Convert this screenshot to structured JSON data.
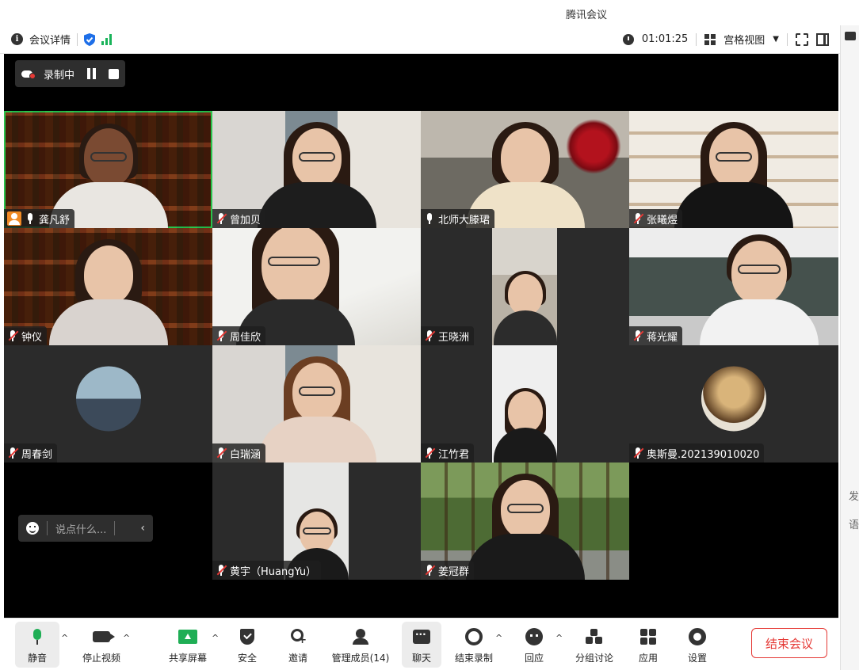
{
  "app": {
    "title": "腾讯会议"
  },
  "topbar": {
    "meeting_details": "会议详情",
    "duration": "01:01:25",
    "view_mode": "宫格视图",
    "colors": {
      "security": "#1e6fe8",
      "signal": "#19b35a"
    }
  },
  "recording": {
    "label": "录制中"
  },
  "participants": [
    {
      "name": "龚凡舒",
      "mic": "on",
      "host": true,
      "active": true
    },
    {
      "name": "曾加贝",
      "mic": "muted"
    },
    {
      "name": "北师大滕珺",
      "mic": "on"
    },
    {
      "name": "张曦煜",
      "mic": "muted"
    },
    {
      "name": "钟仪",
      "mic": "muted"
    },
    {
      "name": "周佳欣",
      "mic": "muted"
    },
    {
      "name": "王晓洲",
      "mic": "muted"
    },
    {
      "name": "蒋光耀",
      "mic": "muted"
    },
    {
      "name": "周春剑",
      "mic": "muted",
      "avatar": true
    },
    {
      "name": "白瑞涵",
      "mic": "muted"
    },
    {
      "name": "江竹君",
      "mic": "muted"
    },
    {
      "name": "奥斯曼.202139010020",
      "mic": "muted",
      "avatar": true
    },
    {
      "name": "黄宇（HuangYu）",
      "mic": "muted"
    },
    {
      "name": "姜冠群",
      "mic": "muted"
    }
  ],
  "chat": {
    "placeholder": "说点什么..."
  },
  "toolbar": {
    "mute": "静音",
    "stop_video": "停止视频",
    "share_screen": "共享屏幕",
    "security": "安全",
    "invite": "邀请",
    "manage_members": "管理成员(14)",
    "chat": "聊天",
    "end_recording": "结束录制",
    "react": "回应",
    "breakout": "分组讨论",
    "apps": "应用",
    "settings": "设置",
    "end_meeting": "结束会议",
    "colors": {
      "end": "#e53935",
      "mic": "#1fae55"
    }
  },
  "side_panel": {
    "chars": [
      "发",
      "语"
    ]
  }
}
